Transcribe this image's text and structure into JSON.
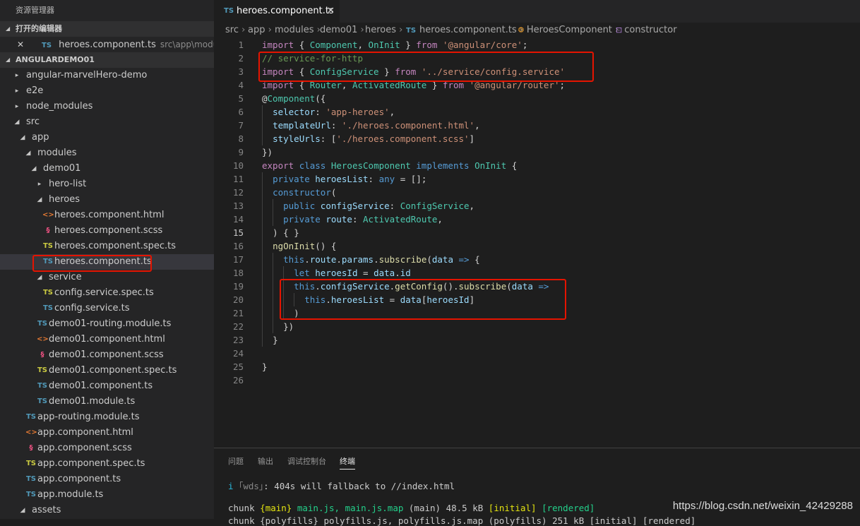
{
  "explorer": {
    "title": "资源管理器",
    "open_editors_header": "打开的编辑器",
    "open_editor": {
      "close_glyph": "✕",
      "type_badge": "TS",
      "name": "heroes.component.ts",
      "path": "src\\app\\modules\\de..."
    },
    "project_header": "ANGULARDEMO01",
    "tree": [
      {
        "label": "angular-marvelHero-demo",
        "type": "folder",
        "expanded": false
      },
      {
        "label": "e2e",
        "type": "folder",
        "expanded": false
      },
      {
        "label": "node_modules",
        "type": "folder",
        "expanded": false
      },
      {
        "label": "src",
        "type": "folder",
        "expanded": true
      },
      {
        "label": "app",
        "type": "folder",
        "expanded": true
      },
      {
        "label": "modules",
        "type": "folder",
        "expanded": true
      },
      {
        "label": "demo01",
        "type": "folder",
        "expanded": true
      },
      {
        "label": "hero-list",
        "type": "folder",
        "expanded": false
      },
      {
        "label": "heroes",
        "type": "folder",
        "expanded": true
      },
      {
        "label": "heroes.component.html",
        "type": "html"
      },
      {
        "label": "heroes.component.scss",
        "type": "scss"
      },
      {
        "label": "heroes.component.spec.ts",
        "type": "spec"
      },
      {
        "label": "heroes.component.ts",
        "type": "ts",
        "selected": true
      },
      {
        "label": "service",
        "type": "folder",
        "expanded": true
      },
      {
        "label": "config.service.spec.ts",
        "type": "spec"
      },
      {
        "label": "config.service.ts",
        "type": "ts"
      },
      {
        "label": "demo01-routing.module.ts",
        "type": "ts"
      },
      {
        "label": "demo01.component.html",
        "type": "html"
      },
      {
        "label": "demo01.component.scss",
        "type": "scss"
      },
      {
        "label": "demo01.component.spec.ts",
        "type": "spec"
      },
      {
        "label": "demo01.component.ts",
        "type": "ts"
      },
      {
        "label": "demo01.module.ts",
        "type": "ts"
      },
      {
        "label": "app-routing.module.ts",
        "type": "ts"
      },
      {
        "label": "app.component.html",
        "type": "html"
      },
      {
        "label": "app.component.scss",
        "type": "scss"
      },
      {
        "label": "app.component.spec.ts",
        "type": "spec"
      },
      {
        "label": "app.component.ts",
        "type": "ts"
      },
      {
        "label": "app.module.ts",
        "type": "ts"
      },
      {
        "label": "assets",
        "type": "folder",
        "expanded": true
      }
    ]
  },
  "tab": {
    "type_badge": "TS",
    "label": "heroes.component.ts",
    "close_glyph": "✕"
  },
  "breadcrumb": [
    "src",
    "app",
    "modules",
    "demo01",
    "heroes",
    "heroes.component.ts",
    "HeroesComponent",
    "constructor"
  ],
  "breadcrumb_sep": "›",
  "breadcrumb_ts_badge": "TS",
  "editor": {
    "current_line": 15,
    "lines": [
      "import { Component, OnInit } from '@angular/core';",
      "// service-for-http",
      "import { ConfigService } from '../service/config.service'",
      "import { Router, ActivatedRoute } from '@angular/router';",
      "@Component({",
      "  selector: 'app-heroes',",
      "  templateUrl: './heroes.component.html',",
      "  styleUrls: ['./heroes.component.scss']",
      "})",
      "export class HeroesComponent implements OnInit {",
      "  private heroesList: any = [];",
      "  constructor(",
      "    public configService: ConfigService,",
      "    private route: ActivatedRoute,",
      "  ) { }",
      "  ngOnInit() {",
      "    this.route.params.subscribe(data => {",
      "      let heroesId = data.id",
      "      this.configService.getConfig().subscribe(data =>",
      "        this.heroesList = data[heroesId]",
      "      )",
      "    })",
      "  }",
      "",
      "}",
      ""
    ]
  },
  "panel": {
    "tabs": [
      "问题",
      "输出",
      "调试控制台",
      "终端"
    ],
    "active_tab": "终端",
    "terminal": {
      "line1_prefix": "i",
      "line1_tag": "｢wds｣",
      "line1_msg": ": 404s will fallback to //index.html",
      "line2_chunk": "chunk",
      "line2_name": "{main}",
      "line2_files": "main.js, main.js.map",
      "line2_size": "(main) 48.5 kB",
      "line2_initial": "[initial]",
      "line2_rendered": "[rendered]",
      "line3": "chunk {polyfills} polyfills.js, polyfills.js.map (polyfills) 251 kB [initial] [rendered]"
    }
  },
  "watermark": "https://blog.csdn.net/weixin_42429288",
  "colors": {
    "highlight_box": "#e51400",
    "editor_bg": "#1e1e1e",
    "sidebar_bg": "#252526"
  }
}
